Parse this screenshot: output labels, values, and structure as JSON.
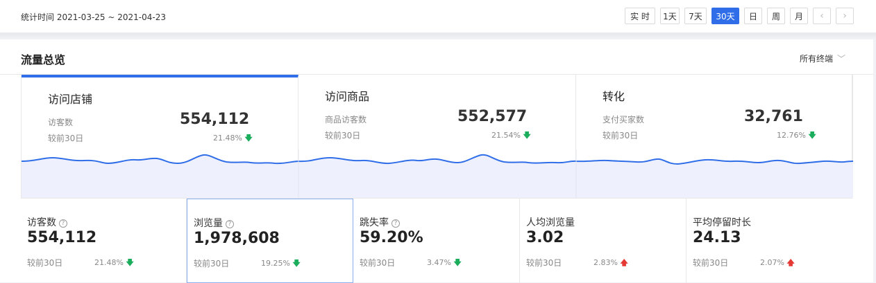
{
  "header": {
    "date_range": "统计时间 2021-03-25 ~ 2021-04-23",
    "time_buttons": [
      {
        "label": "实 时"
      },
      {
        "label": "1天"
      },
      {
        "label": "7天"
      },
      {
        "label": "30天",
        "active": true
      },
      {
        "label": "日"
      },
      {
        "label": "周"
      },
      {
        "label": "月"
      }
    ],
    "prev_icon": "‹",
    "next_icon": "›"
  },
  "panel": {
    "title": "流量总览",
    "terminal_select": "所有终端",
    "terminal_chevron": "﹀"
  },
  "cards": [
    {
      "title": "访问店铺",
      "metric": "访客数",
      "value": "554,112",
      "compare": "较前30日",
      "pct": "21.48%",
      "trend": "down"
    },
    {
      "title": "访问商品",
      "metric": "商品访客数",
      "value": "552,577",
      "compare": "较前30日",
      "pct": "21.54%",
      "trend": "down"
    },
    {
      "title": "转化",
      "metric": "支付买家数",
      "value": "32,761",
      "compare": "较前30日",
      "pct": "12.76%",
      "trend": "down"
    }
  ],
  "stats": [
    {
      "label": "访客数",
      "help": "?",
      "value": "554,112",
      "compare": "较前30日",
      "pct": "21.48%",
      "trend": "down",
      "arrow": "🡇"
    },
    {
      "label": "浏览量",
      "help": "?",
      "value": "1,978,608",
      "compare": "较前30日",
      "pct": "19.25%",
      "trend": "down",
      "arrow": "🡇"
    },
    {
      "label": "跳失率",
      "help": "?",
      "value": "59.20%",
      "compare": "较前30日",
      "pct": "3.47%",
      "trend": "down",
      "arrow": "🡇"
    },
    {
      "label": "人均浏览量",
      "value": "3.02",
      "compare": "较前30日",
      "pct": "2.83%",
      "trend": "up",
      "arrow": "🡅"
    },
    {
      "label": "平均停留时长",
      "value": "24.13",
      "compare": "较前30日",
      "pct": "2.07%",
      "trend": "up",
      "arrow": "🡅"
    }
  ],
  "colors": {
    "accent": "#2f6ee8",
    "down": "#1aad5b",
    "up": "#e53935",
    "spark_fill": "#eef1fd"
  }
}
